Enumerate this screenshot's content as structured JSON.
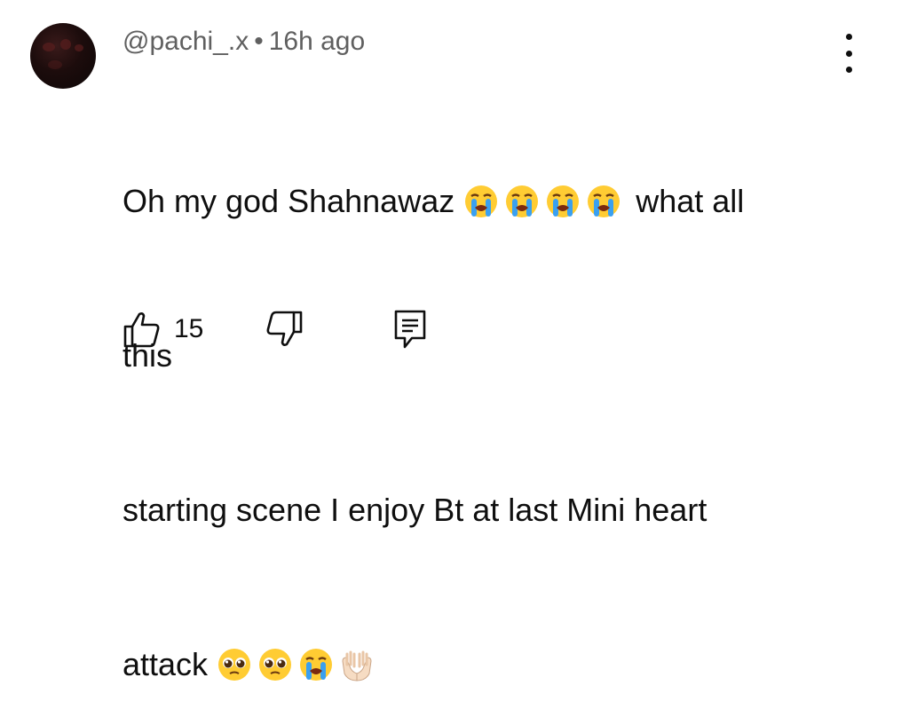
{
  "comment": {
    "username": "@pachi_.x",
    "separator": "•",
    "time_ago": "16h ago",
    "lines": {
      "l1_text": "Oh my god Shahnawaz ",
      "l1_after": " what all",
      "l2": "this",
      "l3": " starting scene  I enjoy  Bt at last Mini heart",
      "l4": "attack "
    },
    "emojis": {
      "line1": [
        "loudly-crying-face",
        "loudly-crying-face",
        "loudly-crying-face",
        "loudly-crying-face"
      ],
      "line4": [
        "pleading-face",
        "pleading-face",
        "loudly-crying-face",
        "palms-up-together"
      ]
    },
    "like_count": "15"
  },
  "icons": [
    "avatar",
    "more-vert-icon",
    "thumbs-up-icon",
    "thumbs-down-icon",
    "reply-icon"
  ],
  "colors": {
    "text": "#0f0f0f",
    "meta": "#606060",
    "background": "#ffffff"
  }
}
